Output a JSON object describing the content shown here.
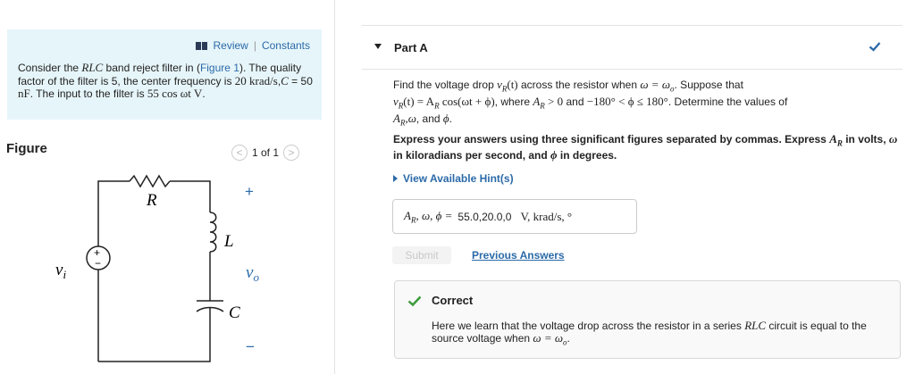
{
  "left": {
    "review_label": "Review",
    "separator": "|",
    "constants_label": "Constants",
    "problem": {
      "p1": "Consider the ",
      "rlc": "RLC",
      "p2": " band reject filter in (",
      "figure_link": "Figure 1",
      "p3": "). The quality factor of the filter is 5, the center frequency is ",
      "freq": "20 krad/s",
      "p4": ",",
      "c_sym": "C",
      "p5": " = 50 ",
      "c_unit": "nF",
      "p6": ". The input to the filter is ",
      "input": "55 cos ωt V",
      "p7": "."
    },
    "figure_label": "Figure",
    "pager": {
      "prev": "<",
      "text": "1 of 1",
      "next": ">"
    },
    "circuit": {
      "R": "R",
      "L": "L",
      "C": "C",
      "vi": "v",
      "vi_sub": "i",
      "vo": "v",
      "vo_sub": "o",
      "plus_src": "+",
      "minus_src": "−",
      "plus_out": "+",
      "minus_out": "−"
    }
  },
  "right": {
    "part_title": "Part A",
    "question": {
      "t1": "Find the voltage drop ",
      "vr": "v",
      "vr_sub": "R",
      "vr_arg": "(t)",
      "t2": " across the resistor when ",
      "cond": "ω = ω",
      "cond_sub": "o",
      "t3": ". Suppose that",
      "eq": "v",
      "eq_sub": "R",
      "eq_rest": "(t) = A",
      "eq_sub2": "R",
      "eq_rest2": " cos(ωt + ϕ)",
      "t4": ", where ",
      "ar": "A",
      "ar_sub": "R",
      "ar_rest": " > 0",
      "t5": " and ",
      "phi_range": "−180° < ϕ ≤ 180°",
      "t6": ". Determine the values of",
      "vals": "A",
      "vals_sub": "R",
      "vals_rest": ",ω",
      "t7": ", and ",
      "phi": "ϕ",
      "t8": "."
    },
    "instructions": {
      "i1": "Express your answers using three significant figures separated by commas. Express ",
      "ar": "A",
      "ar_sub": "R",
      "i2": " in volts, ",
      "w": "ω",
      "i3": " in kiloradians per second, and ",
      "phi": "ϕ",
      "i4": " in degrees."
    },
    "hint_label": "View Available Hint(s)",
    "answer": {
      "vars": "A",
      "vars_sub": "R",
      "vars_rest": ", ω, ϕ =",
      "value": "55.0,20.0,0",
      "units": "V, krad/s, °"
    },
    "submit_label": "Submit",
    "previous_answers_label": "Previous Answers",
    "feedback": {
      "title": "Correct",
      "f1": "Here we learn that the voltage drop across the resistor in a series ",
      "rlc": "RLC",
      "f2": " circuit is equal to the source voltage when ",
      "cond": "ω = ω",
      "cond_sub": "o",
      "f3": "."
    },
    "colors": {
      "accent": "#2b6aa8",
      "success": "#3b9b3b",
      "panel": "#e6f5f9"
    }
  }
}
